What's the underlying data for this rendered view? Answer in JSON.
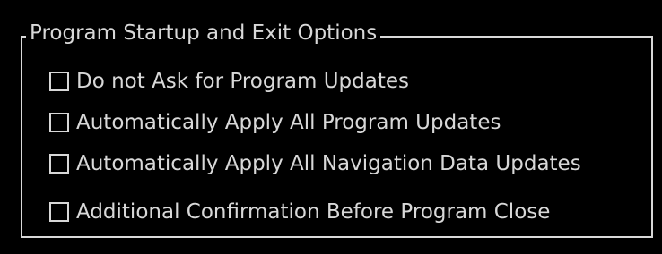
{
  "group": {
    "title": "Program Startup and Exit Options",
    "options": [
      {
        "label": "Do not Ask for Program Updates",
        "checked": false
      },
      {
        "label": "Automatically Apply All Program Updates",
        "checked": false
      },
      {
        "label": "Automatically Apply All Navigation Data Updates",
        "checked": false
      },
      {
        "label": "Additional Confirmation Before Program Close",
        "checked": false
      }
    ]
  },
  "colors": {
    "background": "#000000",
    "foreground": "#d8d8d8"
  }
}
